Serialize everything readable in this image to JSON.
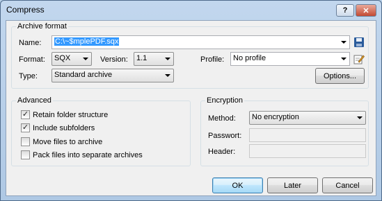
{
  "window": {
    "title": "Compress",
    "help_glyph": "?",
    "close_glyph": "✕"
  },
  "archive": {
    "group_label": "Archive format",
    "name_label": "Name:",
    "name_value": "C:\\~$mplePDF.sqx",
    "format_label": "Format:",
    "format_value": "SQX",
    "version_label": "Version:",
    "version_value": "1.1",
    "profile_label": "Profile:",
    "profile_value": "No profile",
    "type_label": "Type:",
    "type_value": "Standard archive",
    "options_button": "Options..."
  },
  "advanced": {
    "group_label": "Advanced",
    "options": [
      {
        "label": "Retain folder structure",
        "checked": true
      },
      {
        "label": "Include subfolders",
        "checked": true
      },
      {
        "label": "Move files to archive",
        "checked": false
      },
      {
        "label": "Pack files into separate archives",
        "checked": false
      }
    ]
  },
  "encryption": {
    "group_label": "Encryption",
    "method_label": "Method:",
    "method_value": "No encryption",
    "password_label": "Passwort:",
    "header_label": "Header:"
  },
  "buttons": {
    "ok": "OK",
    "later": "Later",
    "cancel": "Cancel"
  },
  "colors": {
    "accent": "#3399ff",
    "window_frame": "#b9d1ea",
    "close_red": "#c34a33"
  }
}
